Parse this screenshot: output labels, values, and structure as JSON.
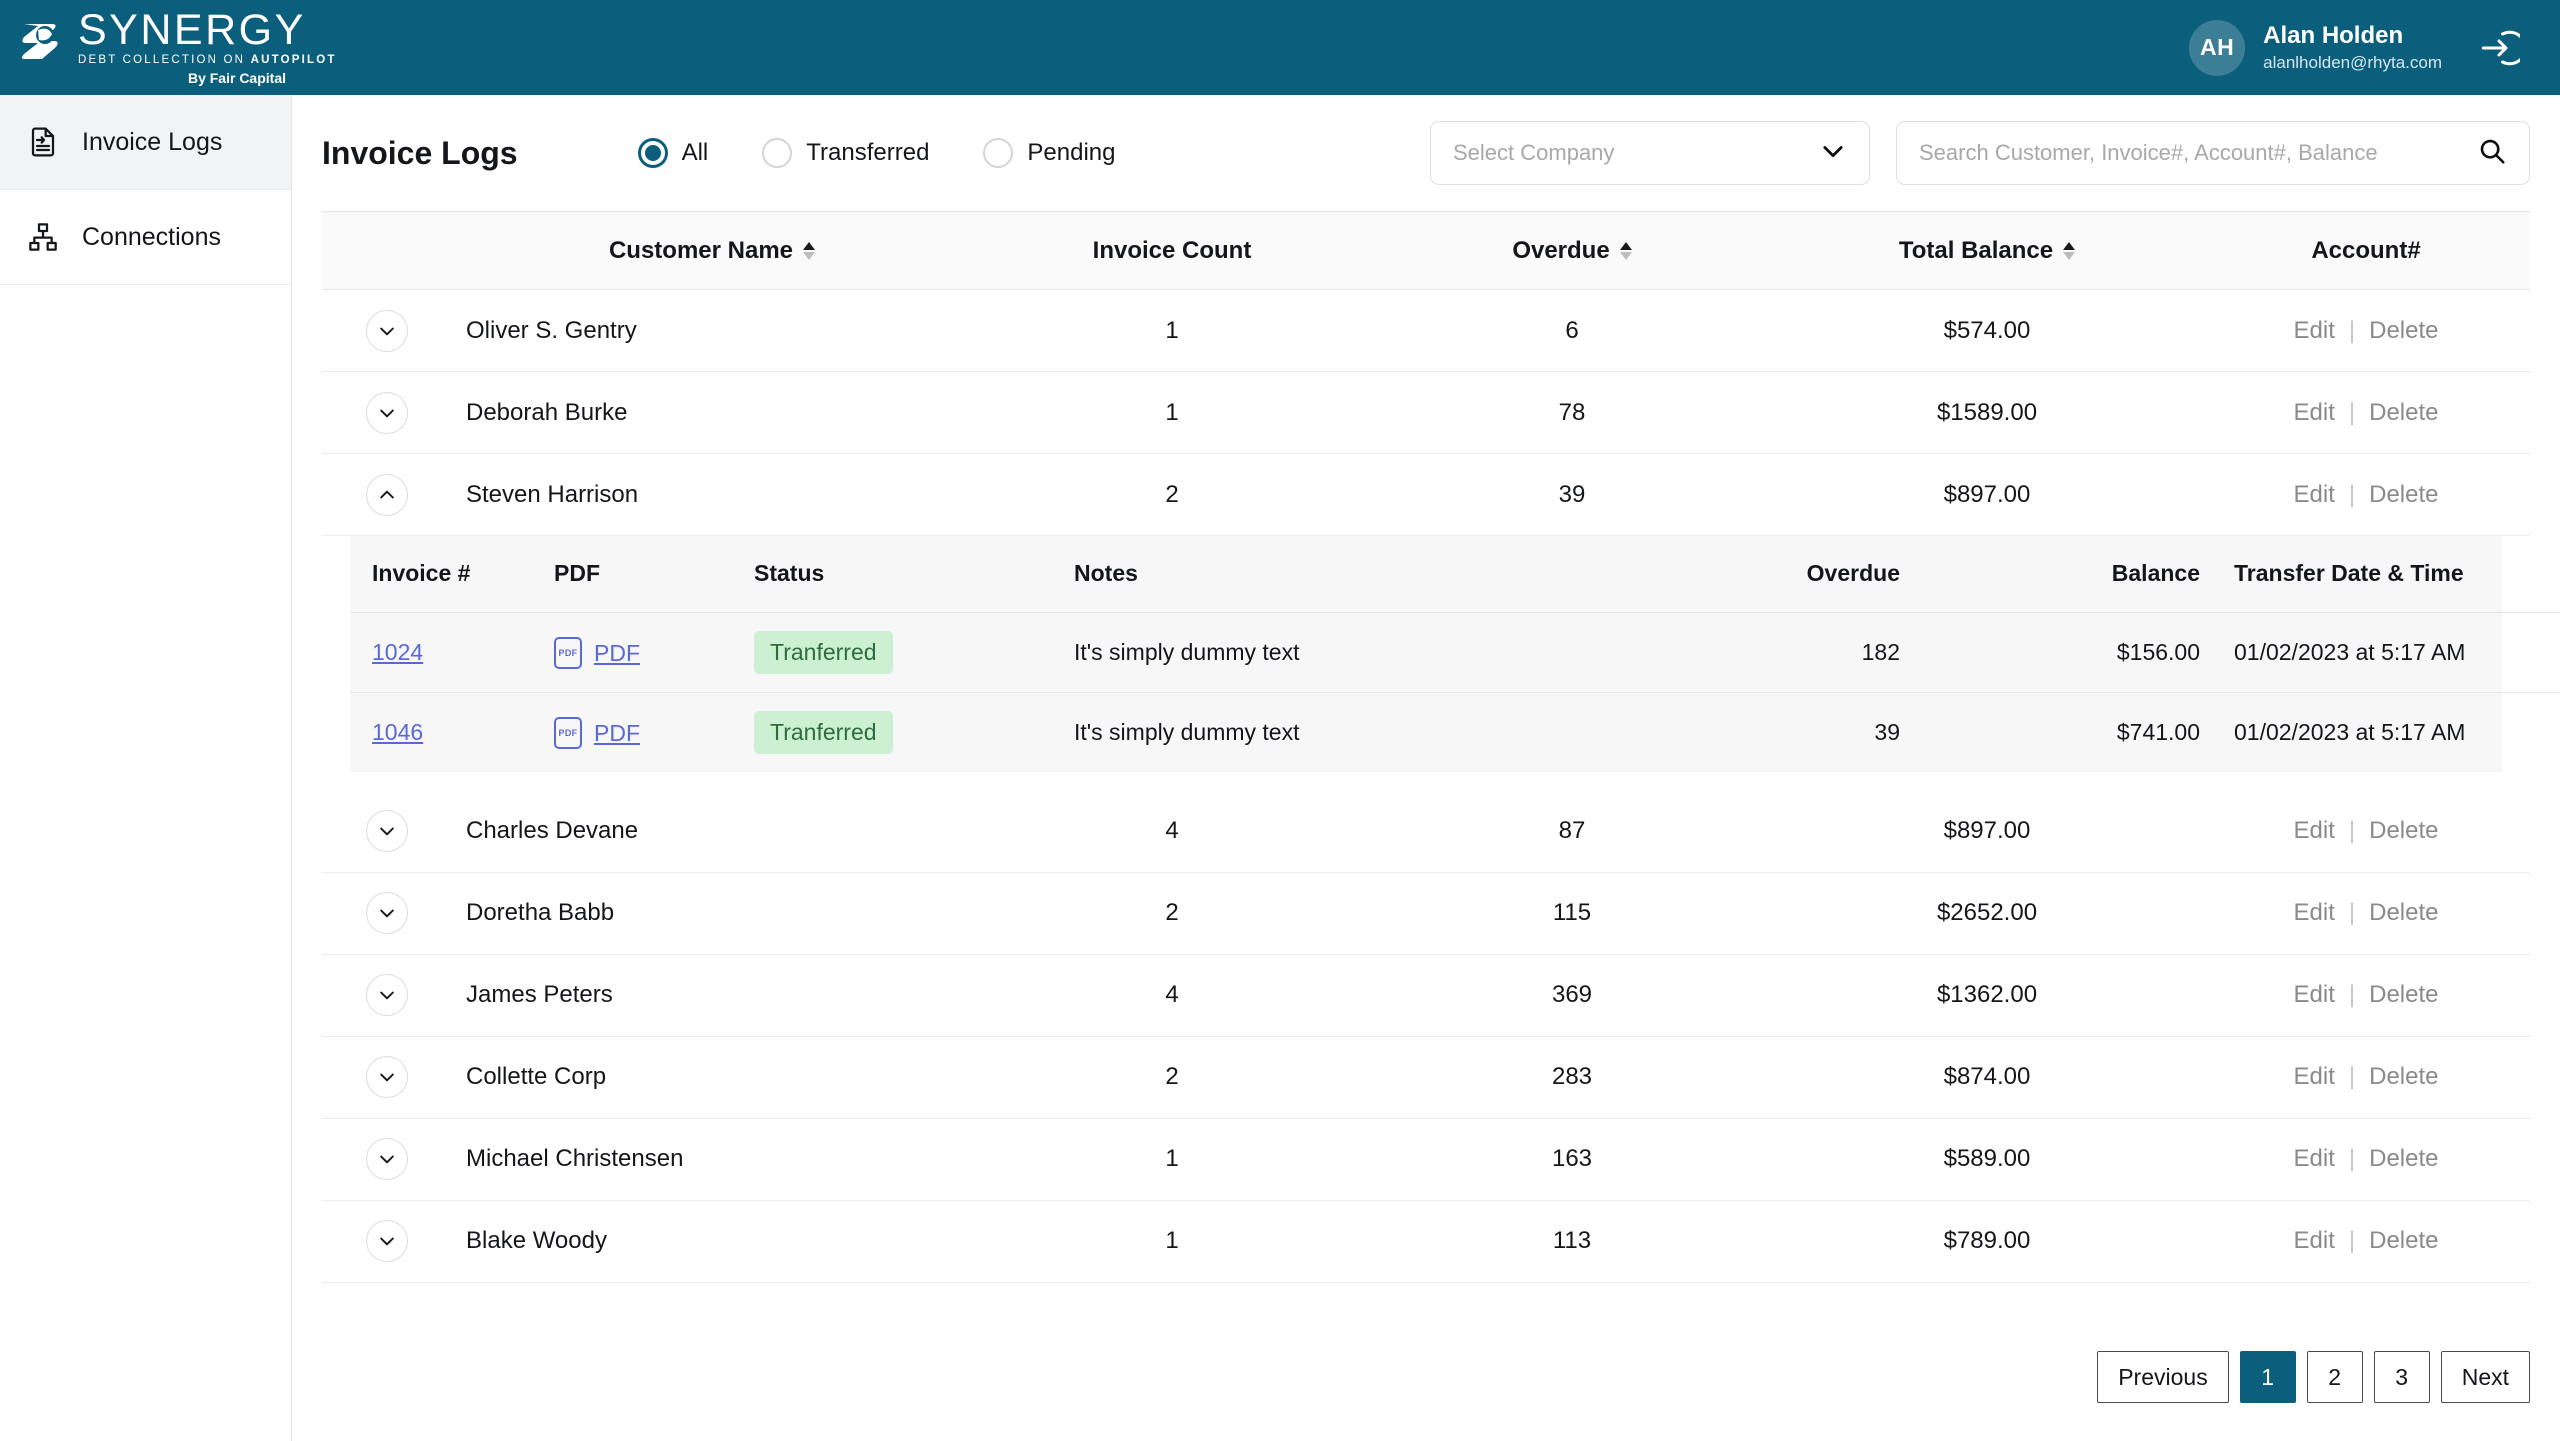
{
  "brand": {
    "name": "SYNERGY",
    "tagline_plain": "DEBT COLLECTION ON ",
    "tagline_bold": "AUTOPILOT",
    "sub": "By Fair Capital"
  },
  "user": {
    "initials": "AH",
    "name": "Alan Holden",
    "email": "alanlholden@rhyta.com",
    "logout_icon": "logout-icon"
  },
  "sidebar": {
    "items": [
      {
        "label": "Invoice Logs",
        "icon": "document-arrow-icon",
        "active": true
      },
      {
        "label": "Connections",
        "icon": "sitemap-icon",
        "active": false
      }
    ]
  },
  "header": {
    "title": "Invoice Logs",
    "filters": [
      {
        "label": "All",
        "checked": true
      },
      {
        "label": "Transferred",
        "checked": false
      },
      {
        "label": "Pending",
        "checked": false
      }
    ],
    "company_select": {
      "placeholder": "Select Company",
      "value": "",
      "icon": "chevron-down-icon"
    },
    "search": {
      "placeholder": "Search Customer, Invoice#, Account#, Balance",
      "value": "",
      "icon": "search-icon"
    }
  },
  "table": {
    "columns": [
      {
        "label": "",
        "sortable": false
      },
      {
        "label": "Customer Name",
        "sortable": true
      },
      {
        "label": "Invoice Count",
        "sortable": false
      },
      {
        "label": "Overdue",
        "sortable": true
      },
      {
        "label": "Total Balance",
        "sortable": true
      },
      {
        "label": "Account#",
        "sortable": false
      }
    ],
    "actions": {
      "edit": "Edit",
      "separator": "|",
      "delete": "Delete"
    },
    "rows": [
      {
        "name": "Oliver S. Gentry",
        "invoice_count": "1",
        "overdue": "6",
        "total_balance": "$574.00",
        "expanded": false
      },
      {
        "name": "Deborah Burke",
        "invoice_count": "1",
        "overdue": "78",
        "total_balance": "$1589.00",
        "expanded": false
      },
      {
        "name": "Steven Harrison",
        "invoice_count": "2",
        "overdue": "39",
        "total_balance": "$897.00",
        "expanded": true
      },
      {
        "name": "Charles Devane",
        "invoice_count": "4",
        "overdue": "87",
        "total_balance": "$897.00",
        "expanded": false
      },
      {
        "name": "Doretha Babb",
        "invoice_count": "2",
        "overdue": "115",
        "total_balance": "$2652.00",
        "expanded": false
      },
      {
        "name": "James Peters",
        "invoice_count": "4",
        "overdue": "369",
        "total_balance": "$1362.00",
        "expanded": false
      },
      {
        "name": "Collette Corp",
        "invoice_count": "2",
        "overdue": "283",
        "total_balance": "$874.00",
        "expanded": false
      },
      {
        "name": "Michael Christensen",
        "invoice_count": "1",
        "overdue": "163",
        "total_balance": "$589.00",
        "expanded": false
      },
      {
        "name": "Blake Woody",
        "invoice_count": "1",
        "overdue": "113",
        "total_balance": "$789.00",
        "expanded": false
      }
    ]
  },
  "subtable": {
    "columns": [
      "Invoice #",
      "PDF",
      "Status",
      "Notes",
      "Overdue",
      "Balance",
      "Transfer Date & Time"
    ],
    "pdf_label": "PDF",
    "pdf_icon_text": "PDF",
    "rows": [
      {
        "invoice": "1024",
        "pdf": "PDF",
        "status": "Tranferred",
        "notes": "It's simply dummy text",
        "overdue": "182",
        "balance": "$156.00",
        "transfer": "01/02/2023 at 5:17 AM"
      },
      {
        "invoice": "1046",
        "pdf": "PDF",
        "status": "Tranferred",
        "notes": "It's simply dummy text",
        "overdue": "39",
        "balance": "$741.00",
        "transfer": "01/02/2023 at 5:17 AM"
      }
    ]
  },
  "pagination": {
    "previous": "Previous",
    "next": "Next",
    "pages": [
      "1",
      "2",
      "3"
    ],
    "current": "1"
  },
  "colors": {
    "brand_teal": "#0b5f7d",
    "badge_bg": "#cdf0d2",
    "badge_text": "#2c6e3b",
    "link_blue": "#5a68d6"
  }
}
